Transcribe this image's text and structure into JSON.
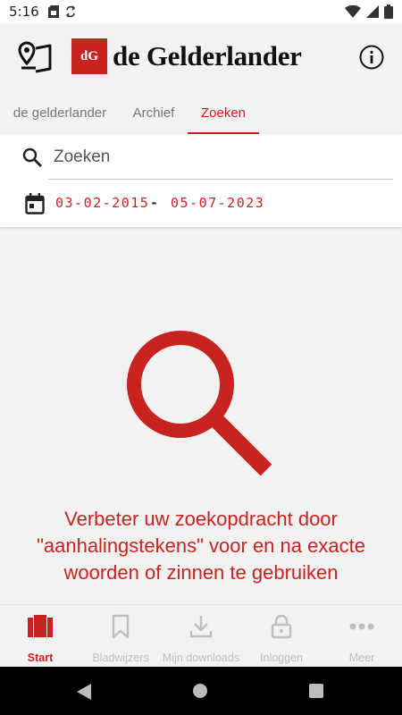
{
  "status_bar": {
    "time": "5:16"
  },
  "header": {
    "logo_mark": "dG",
    "logo_text": "de Gelderlander"
  },
  "tabs": [
    {
      "label": "de gelderlander"
    },
    {
      "label": "Archief"
    },
    {
      "label": "Zoeken"
    }
  ],
  "search": {
    "placeholder": "Zoeken",
    "date_from": "03-02-2015",
    "date_separator": "-",
    "date_to": "05-07-2023"
  },
  "hint": {
    "text": "Verbeter uw zoekopdracht door \"aanhalingstekens\" voor en na exacte woorden of zinnen te gebruiken"
  },
  "bottom_nav": [
    {
      "label": "Start",
      "icon": "newspaper-icon"
    },
    {
      "label": "Bladwijzers",
      "icon": "bookmark-icon"
    },
    {
      "label": "Mijn downloads",
      "icon": "download-icon"
    },
    {
      "label": "Inloggen",
      "icon": "lock-icon"
    },
    {
      "label": "Meer",
      "icon": "more-icon"
    }
  ],
  "colors": {
    "accent": "#c8231f",
    "inactive": "#bfbfbf",
    "background": "#f2f2f2"
  }
}
